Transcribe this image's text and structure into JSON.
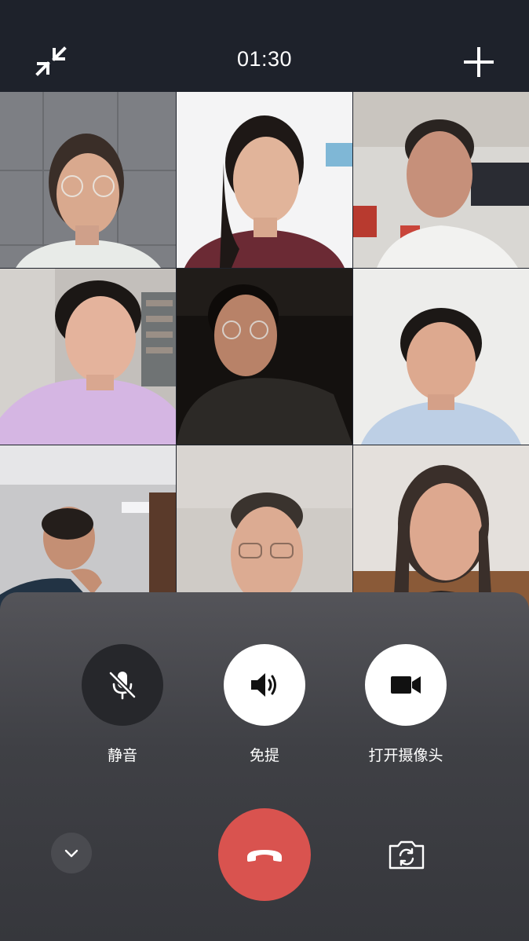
{
  "call": {
    "timer": "01:30"
  },
  "icons": {
    "minimize": "collapse-arrows-icon",
    "add": "plus-icon",
    "mute": "microphone-off-icon",
    "speaker": "speaker-icon",
    "camera": "video-camera-icon",
    "collapse": "chevron-down-icon",
    "hangup": "phone-hangup-icon",
    "flip": "camera-flip-icon"
  },
  "controls": {
    "mute_label": "静音",
    "speaker_label": "免提",
    "camera_label": "打开摄像头"
  },
  "colors": {
    "background": "#1f232c",
    "hangup": "#d9534f",
    "button_light": "#ffffff",
    "button_dark": "#26272b"
  },
  "participants": [
    {
      "position": "top-left"
    },
    {
      "position": "top-center"
    },
    {
      "position": "top-right"
    },
    {
      "position": "middle-left"
    },
    {
      "position": "center"
    },
    {
      "position": "middle-right"
    },
    {
      "position": "bottom-left"
    },
    {
      "position": "bottom-center"
    },
    {
      "position": "bottom-right"
    }
  ]
}
